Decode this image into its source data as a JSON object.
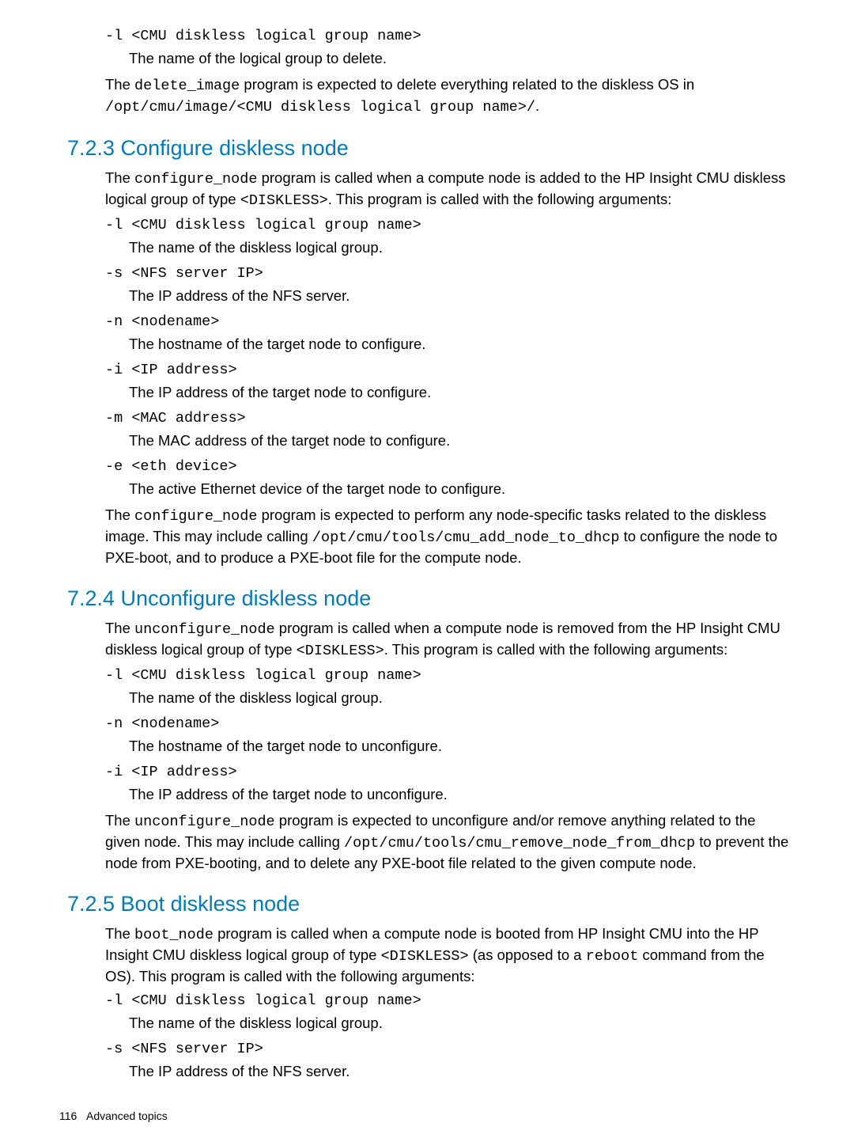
{
  "intro": {
    "arg_flag": "-l",
    "arg_param": "<CMU diskless logical group name>",
    "arg_desc": "The name of the logical group to delete.",
    "p1_a": "The ",
    "p1_b": "delete_image",
    "p1_c": " program is expected to delete everything related to the diskless OS in ",
    "p1_d": "/opt/cmu/image/<CMU diskless logical group name>/",
    "p1_e": "."
  },
  "s723": {
    "title": "7.2.3 Configure diskless node",
    "p1_a": "The ",
    "p1_b": "configure_node",
    "p1_c": " program is called when a compute node is added to the HP Insight CMU diskless logical group of type ",
    "p1_d": "<DISKLESS>",
    "p1_e": ". This program is called with the following arguments:",
    "args": [
      {
        "flag": "-l",
        "param": "<CMU diskless logical group name>",
        "desc": "The name of the diskless logical group."
      },
      {
        "flag": "-s",
        "param": "<NFS server IP>",
        "desc": "The IP address of the NFS server."
      },
      {
        "flag": "-n",
        "param": "<nodename>",
        "desc": "The hostname of the target node to configure."
      },
      {
        "flag": "-i",
        "param": "<IP address>",
        "desc": "The IP address of the target node to configure."
      },
      {
        "flag": "-m",
        "param": "<MAC address>",
        "desc": "The MAC address of the target node to configure."
      },
      {
        "flag": "-e",
        "param": "<eth device>",
        "desc": "The active Ethernet device of the target node to configure."
      }
    ],
    "p2_a": "The ",
    "p2_b": "configure_node",
    "p2_c": " program is expected to perform any node-specific tasks related to the diskless image. This may include calling ",
    "p2_d": "/opt/cmu/tools/cmu_add_node_to_dhcp",
    "p2_e": " to configure the node to PXE-boot, and to produce a PXE-boot file for the compute node."
  },
  "s724": {
    "title": "7.2.4 Unconfigure diskless node",
    "p1_a": "The ",
    "p1_b": "unconfigure_node",
    "p1_c": " program is called when a compute node is removed from the HP Insight CMU diskless logical group of type ",
    "p1_d": "<DISKLESS>",
    "p1_e": ". This program is called with the following arguments:",
    "args": [
      {
        "flag": "-l",
        "param": "<CMU diskless logical group name>",
        "desc": "The name of the diskless logical group."
      },
      {
        "flag": "-n",
        "param": "<nodename>",
        "desc": "The hostname of the target node to unconfigure."
      },
      {
        "flag": "-i",
        "param": "<IP address>",
        "desc": "The IP address of the target node to unconfigure."
      }
    ],
    "p2_a": "The ",
    "p2_b": "unconfigure_node",
    "p2_c": " program is expected to unconfigure and/or remove anything related to the given node. This may include calling ",
    "p2_d": "/opt/cmu/tools/cmu_remove_node_from_dhcp",
    "p2_e": " to prevent the node from PXE-booting, and to delete any PXE-boot file related to the given compute node."
  },
  "s725": {
    "title": "7.2.5 Boot diskless node",
    "p1_a": "The ",
    "p1_b": "boot_node",
    "p1_c": " program is called when a compute node is booted from HP Insight CMU into the HP Insight CMU diskless logical group of type ",
    "p1_d": "<DISKLESS>",
    "p1_e": " (as opposed to a ",
    "p1_f": "reboot",
    "p1_g": " command from the OS). This program is called with the following arguments:",
    "args": [
      {
        "flag": "-l",
        "param": "<CMU diskless logical group name>",
        "desc": "The name of the diskless logical group."
      },
      {
        "flag": "-s",
        "param": "<NFS server IP>",
        "desc": "The IP address of the NFS server."
      }
    ]
  },
  "footer": {
    "page": "116",
    "chapter": "Advanced topics"
  }
}
